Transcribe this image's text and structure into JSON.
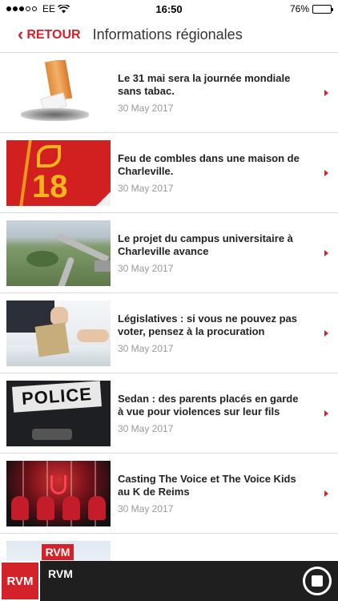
{
  "status_bar": {
    "carrier": "EE",
    "time": "16:50",
    "battery": "76%",
    "battery_level": 0.76
  },
  "nav": {
    "back_label": "RETOUR",
    "title": "Informations régionales"
  },
  "articles": [
    {
      "title": "Le 31 mai sera la journée mondiale sans tabac.",
      "date": "30 May 2017",
      "image": "cigarette-butt"
    },
    {
      "title": "Feu de combles dans une maison de Charleville.",
      "date": "30 May 2017",
      "image": "firefighters-18"
    },
    {
      "title": "Le projet du campus universitaire à Charleville avance",
      "date": "30 May 2017",
      "image": "campus-aerial"
    },
    {
      "title": "Législatives : si vous ne pouvez pas voter, pensez à la procuration",
      "date": "30 May 2017",
      "image": "ballot-box"
    },
    {
      "title": "Sedan : des parents placés en garde à vue pour violences sur leur fils",
      "date": "30 May 2017",
      "image": "police-patch"
    },
    {
      "title": "Casting The Voice et The Voice Kids au K de Reims",
      "date": "30 May 2017",
      "image": "the-voice-stage"
    }
  ],
  "partial_item": {
    "image": "rvm-logo",
    "logo_text": "RVM"
  },
  "thumb_text": {
    "fire_number": "18",
    "police_label": "POLICE"
  },
  "player": {
    "logo_text": "RVM",
    "station_name": "RVM"
  },
  "colors": {
    "accent": "#d3222a",
    "player_bg": "#1f1f1f"
  }
}
